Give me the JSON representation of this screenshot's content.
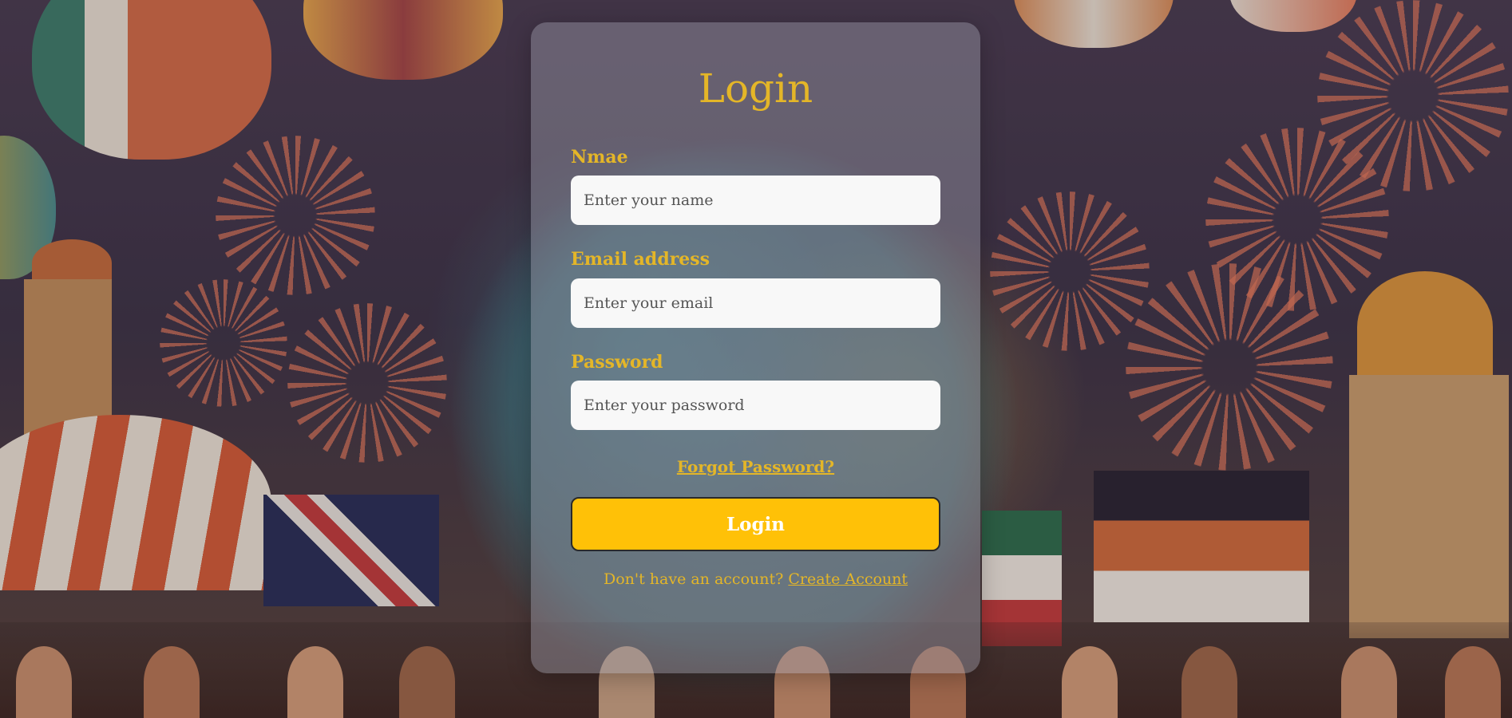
{
  "page": {
    "title": "Login"
  },
  "form": {
    "name_label": "Nmae",
    "name_placeholder": "Enter your name",
    "email_label": "Email address",
    "email_placeholder": "Enter your email",
    "password_label": "Password",
    "password_placeholder": "Enter your password",
    "forgot_password": "Forgot Password?",
    "submit_label": "Login",
    "signup_prompt": "Don't have an account?",
    "signup_link": "Create Account"
  },
  "theme": {
    "accent": "#e4b628",
    "button_color": "#ffc107",
    "input_background": "#f8f8f8"
  }
}
